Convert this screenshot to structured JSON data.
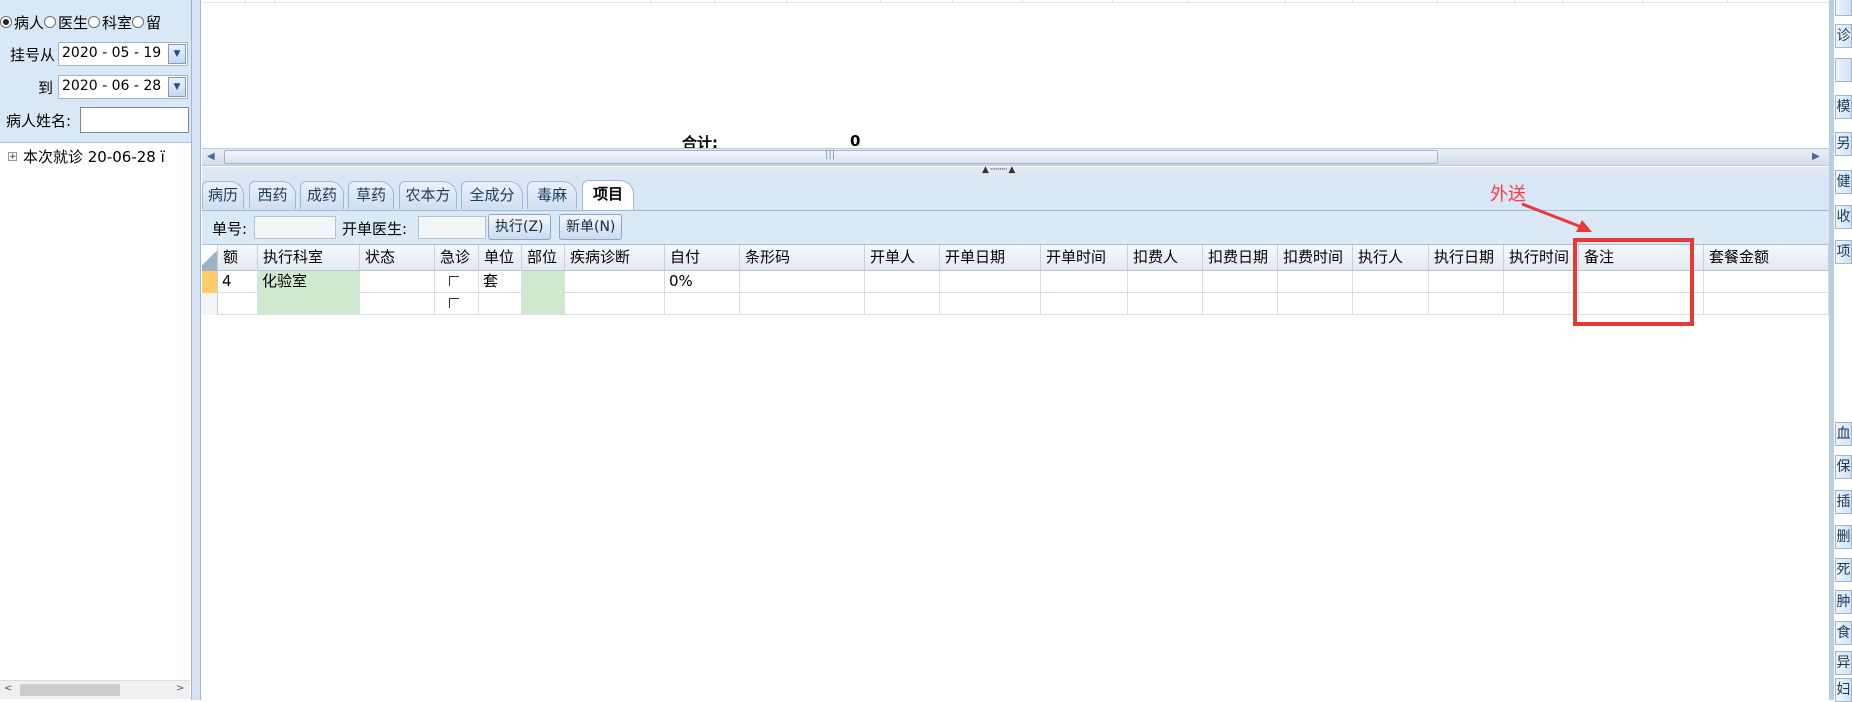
{
  "filter": {
    "radios": [
      {
        "label": "病人",
        "checked": true
      },
      {
        "label": "医生",
        "checked": false
      },
      {
        "label": "科室",
        "checked": false
      },
      {
        "label": "留",
        "checked": false
      }
    ],
    "date_from_label": "挂号从",
    "date_from_value": "2020 - 05 - 19",
    "date_to_label": "到",
    "date_to_value": "2020 - 06 - 28",
    "patient_name_label": "病人姓名:",
    "patient_name_value": ""
  },
  "tree": {
    "toggle": "+",
    "item": "本次就诊 20-06-28 ï"
  },
  "upper": {
    "total_label": "合计:",
    "total_value": "0"
  },
  "tabs": [
    {
      "label": "病历",
      "active": false
    },
    {
      "label": "西药",
      "active": false
    },
    {
      "label": "成药",
      "active": false
    },
    {
      "label": "草药",
      "active": false
    },
    {
      "label": "农本方",
      "active": false
    },
    {
      "label": "全成分",
      "active": false
    },
    {
      "label": "毒麻",
      "active": false
    },
    {
      "label": "项目",
      "active": true
    }
  ],
  "toolbar": {
    "order_no_label": "单号:",
    "order_no_value": "",
    "doctor_label": "开单医生:",
    "doctor_value": "",
    "execute_label": "执行(Z)",
    "new_label": "新单(N)"
  },
  "grid": {
    "columns": [
      "额",
      "执行科室",
      "状态",
      "急诊",
      "单位",
      "部位",
      "疾病诊断",
      "自付",
      "条形码",
      "开单人",
      "开单日期",
      "开单时间",
      "扣费人",
      "扣费日期",
      "扣费时间",
      "执行人",
      "执行日期",
      "执行时间",
      "备注",
      "套餐金额"
    ],
    "rows": [
      {
        "amount": "4",
        "dept": "化验室",
        "status": "",
        "unit": "套",
        "part": "",
        "diagnosis": "",
        "self_pay": "0%",
        "current": true
      },
      {
        "amount": "",
        "dept": "",
        "status": "",
        "unit": "",
        "part": "",
        "diagnosis": "",
        "self_pay": "",
        "current": false
      }
    ]
  },
  "annotation": {
    "label": "外送",
    "color": "#e63a3a"
  },
  "sidebar": {
    "buttons": [
      "",
      "诊",
      "",
      "模",
      "另",
      "健",
      "收",
      "项",
      "血",
      "保",
      "插",
      "删",
      "死",
      "肿",
      "食",
      "异",
      "妇"
    ]
  }
}
